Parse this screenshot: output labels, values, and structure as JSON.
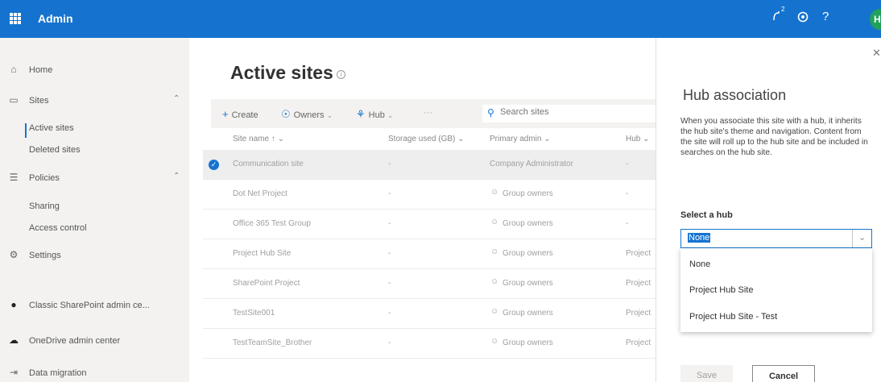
{
  "header": {
    "app_title": "Admin",
    "icons": [
      "waffle-icon",
      "notification-icon",
      "settings-icon",
      "help-icon"
    ],
    "notification_count": "2",
    "help_glyph": "?",
    "avatar_initials": "H",
    "accent": "#1573cf"
  },
  "nav": {
    "home": "Home",
    "sites": "Sites",
    "active_sites": "Active sites",
    "deleted_sites": "Deleted sites",
    "policies": "Policies",
    "sharing": "Sharing",
    "access_control": "Access control",
    "settings": "Settings",
    "classic_admin": "Classic SharePoint admin ce...",
    "onedrive_admin": "OneDrive admin center",
    "data_migration": "Data migration"
  },
  "main": {
    "title": "Active sites",
    "toolbar": {
      "create": "Create",
      "owners": "Owners",
      "hub": "Hub",
      "more": "···",
      "search_placeholder": "Search sites"
    },
    "columns": {
      "site_name": "Site name ↑",
      "storage": "Storage used (GB)",
      "primary_admin": "Primary admin",
      "hub": "Hub"
    },
    "rows": [
      {
        "name": "Communication site",
        "storage": "-",
        "admin": "Company Administrator",
        "hub": "-",
        "selected": true
      },
      {
        "name": "Dot Net Project",
        "storage": "-",
        "admin": "Group owners",
        "hub": "-",
        "selected": false
      },
      {
        "name": "Office 365 Test Group",
        "storage": "-",
        "admin": "Group owners",
        "hub": "-",
        "selected": false
      },
      {
        "name": "Project Hub Site",
        "storage": "-",
        "admin": "Group owners",
        "hub": "Project",
        "selected": false
      },
      {
        "name": "SharePoint Project",
        "storage": "-",
        "admin": "Group owners",
        "hub": "Project",
        "selected": false
      },
      {
        "name": "TestSite001",
        "storage": "-",
        "admin": "Group owners",
        "hub": "Project",
        "selected": false
      },
      {
        "name": "TestTeamSite_Brother",
        "storage": "-",
        "admin": "Group owners",
        "hub": "Project",
        "selected": false
      }
    ]
  },
  "panel": {
    "title": "Hub association",
    "description": "When you associate this site with a hub, it inherits the hub site's theme and navigation. Content from the site will roll up to the hub site and be included in searches on the hub site.",
    "select_label": "Select a hub",
    "selected_value": "None",
    "options": [
      "None",
      "Project Hub Site",
      "Project Hub Site - Test"
    ],
    "save": "Save",
    "cancel": "Cancel"
  }
}
